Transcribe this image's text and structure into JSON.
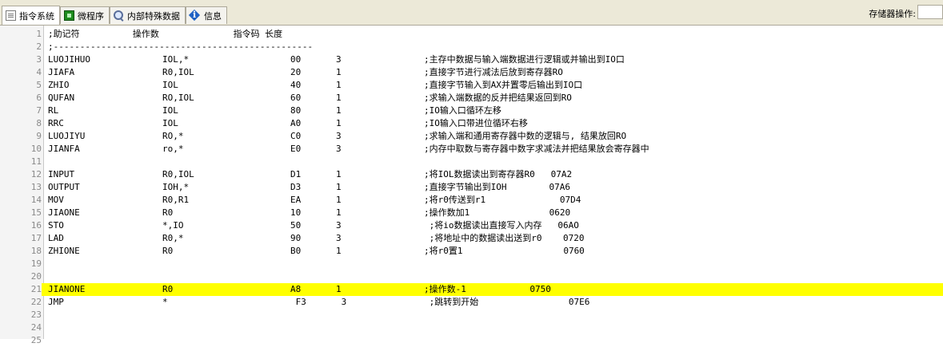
{
  "tabs": [
    {
      "label": "指令系统",
      "icon": "document-icon",
      "active": true
    },
    {
      "label": "微程序",
      "icon": "microchip-icon",
      "active": false
    },
    {
      "label": "内部特殊数据",
      "icon": "magnifier-icon",
      "active": false
    },
    {
      "label": "信息",
      "icon": "info-icon",
      "active": false
    }
  ],
  "storage_label": "存储器操作:",
  "highlight_color": "#ffff00",
  "lines": [
    {
      "n": "1",
      "text": ";助记符          操作数              指令码 长度"
    },
    {
      "n": "2",
      "text": ";-------------------------------------------------"
    },
    {
      "n": "3",
      "mn": "LUOJIHUO",
      "op": "IOL,*",
      "code": "00",
      "len": "3",
      "comment": ";主存中数据与输入端数据进行逻辑或并输出到IO口"
    },
    {
      "n": "4",
      "mn": "JIAFA",
      "op": "R0,IOL",
      "code": "20",
      "len": "1",
      "comment": ";直接字节进行减法后放到寄存器RO"
    },
    {
      "n": "5",
      "mn": "ZHIO",
      "op": "IOL",
      "code": "40",
      "len": "1",
      "comment": ";直接字节输入到AX并置零后输出到IO口"
    },
    {
      "n": "6",
      "mn": "QUFAN",
      "op": "RO,IOL",
      "code": "60",
      "len": "1",
      "comment": ";求输入端数据的反并把结果返回到RO"
    },
    {
      "n": "7",
      "mn": "RL",
      "op": "IOL",
      "code": "80",
      "len": "1",
      "comment": ";IO输入口循环左移"
    },
    {
      "n": "8",
      "mn": "RRC",
      "op": "IOL",
      "code": "A0",
      "len": "1",
      "comment": ";IO输入口带进位循环右移"
    },
    {
      "n": "9",
      "mn": "LUOJIYU",
      "op": "RO,*",
      "code": "C0",
      "len": "3",
      "comment": ";求输入端和通用寄存器中数的逻辑与, 结果放回RO"
    },
    {
      "n": "10",
      "mn": "JIANFA",
      "op": "ro,*",
      "code": "E0",
      "len": "3",
      "comment": ";内存中取数与寄存器中数字求减法并把结果放会寄存器中"
    },
    {
      "n": "11"
    },
    {
      "n": "12",
      "mn": "INPUT",
      "op": "R0,IOL",
      "code": "D1",
      "len": "1",
      "comment": ";将IOL数据读出到寄存器R0   07A2"
    },
    {
      "n": "13",
      "mn": "OUTPUT",
      "op": "IOH,*",
      "code": "D3",
      "len": "1",
      "comment": ";直接字节输出到IOH        07A6"
    },
    {
      "n": "14",
      "mn": "MOV",
      "op": "R0,R1",
      "code": "EA",
      "len": "1",
      "comment": ";将r0传送到r1              07D4"
    },
    {
      "n": "15",
      "mn": "JIAONE",
      "op": "R0",
      "code": "10",
      "len": "1",
      "comment": ";操作数加1               0620"
    },
    {
      "n": "16",
      "mn": "STO",
      "op": "*,IO",
      "code": "50",
      "len": "3",
      "comment": " ;将io数据读出直接写入内存   06AO"
    },
    {
      "n": "17",
      "mn": "LAD",
      "op": "R0,*",
      "code": "90",
      "len": "3",
      "comment": " ;将地址中的数据读出送到r0    0720"
    },
    {
      "n": "18",
      "mn": "ZHIONE",
      "op": "R0",
      "code": "B0",
      "len": "1",
      "comment": ";将r0置1                   0760"
    },
    {
      "n": "19"
    },
    {
      "n": "20"
    },
    {
      "n": "21",
      "mn": "JIANONE",
      "op": "R0",
      "code": "A8",
      "len": "1",
      "comment": ";操作数-1            0750",
      "highlight": true
    },
    {
      "n": "22",
      "mn": "JMP",
      "op": "*",
      "code": " F3",
      "len": " 3",
      "comment": " ;跳转到开始                 07E6"
    },
    {
      "n": "23"
    },
    {
      "n": "24"
    },
    {
      "n": "25"
    }
  ]
}
